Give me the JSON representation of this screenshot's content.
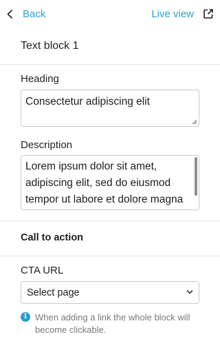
{
  "header": {
    "back_label": "Back",
    "live_view_label": "Live view",
    "accent_color": "#2a9fd0"
  },
  "block": {
    "title": "Text block 1"
  },
  "heading": {
    "label": "Heading",
    "value": "Consectetur adipiscing elit"
  },
  "description": {
    "label": "Description",
    "value": "Lorem ipsum dolor sit amet, adipiscing elit, sed do eiusmod tempor ut labore et dolore magna"
  },
  "cta": {
    "section_title": "Call to action",
    "url_label": "CTA URL",
    "select_value": "Select page",
    "info_text": "When adding a link the whole block will become clickable.",
    "info_icon": "info-icon"
  }
}
